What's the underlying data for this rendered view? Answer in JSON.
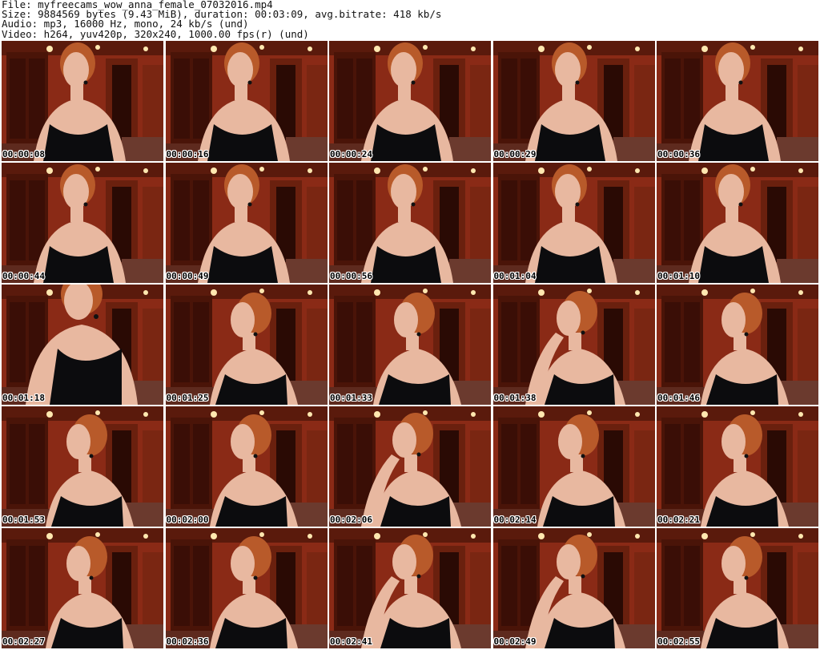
{
  "header": {
    "file": "File: myfreecams_wow_anna_female_07032016.mp4",
    "size": "Size: 9884569 bytes (9.43 MiB), duration: 00:03:09, avg.bitrate: 418 kb/s",
    "audio": "Audio: mp3, 16000 Hz, mono, 24 kb/s (und)",
    "video": "Video: h264, yuv420p, 320x240, 1000.00 fps(r) (und)"
  },
  "thumbnails": [
    {
      "timestamp": "00:00:08",
      "pose": "front"
    },
    {
      "timestamp": "00:00:16",
      "pose": "front"
    },
    {
      "timestamp": "00:00:24",
      "pose": "front"
    },
    {
      "timestamp": "00:00:29",
      "pose": "front"
    },
    {
      "timestamp": "00:00:36",
      "pose": "front"
    },
    {
      "timestamp": "00:00:44",
      "pose": "front"
    },
    {
      "timestamp": "00:00:49",
      "pose": "front"
    },
    {
      "timestamp": "00:00:56",
      "pose": "front"
    },
    {
      "timestamp": "00:01:04",
      "pose": "front"
    },
    {
      "timestamp": "00:01:10",
      "pose": "front"
    },
    {
      "timestamp": "00:01:18",
      "pose": "close"
    },
    {
      "timestamp": "00:01:25",
      "pose": "profile"
    },
    {
      "timestamp": "00:01:33",
      "pose": "profile"
    },
    {
      "timestamp": "00:01:38",
      "pose": "hand"
    },
    {
      "timestamp": "00:01:46",
      "pose": "profile"
    },
    {
      "timestamp": "00:01:53",
      "pose": "profile"
    },
    {
      "timestamp": "00:02:00",
      "pose": "profile"
    },
    {
      "timestamp": "00:02:06",
      "pose": "hand"
    },
    {
      "timestamp": "00:02:14",
      "pose": "profile"
    },
    {
      "timestamp": "00:02:21",
      "pose": "profile"
    },
    {
      "timestamp": "00:02:27",
      "pose": "profile"
    },
    {
      "timestamp": "00:02:36",
      "pose": "profile"
    },
    {
      "timestamp": "00:02:41",
      "pose": "hand"
    },
    {
      "timestamp": "00:02:49",
      "pose": "hand"
    },
    {
      "timestamp": "00:02:55",
      "pose": "profile"
    }
  ],
  "colors": {
    "wall": "#8a2a16",
    "wood": "#4a1408",
    "skin": "#e8b8a0",
    "hair": "#b85a2a",
    "dress": "#0c0c0e",
    "lamp": "#ffe8b0"
  }
}
